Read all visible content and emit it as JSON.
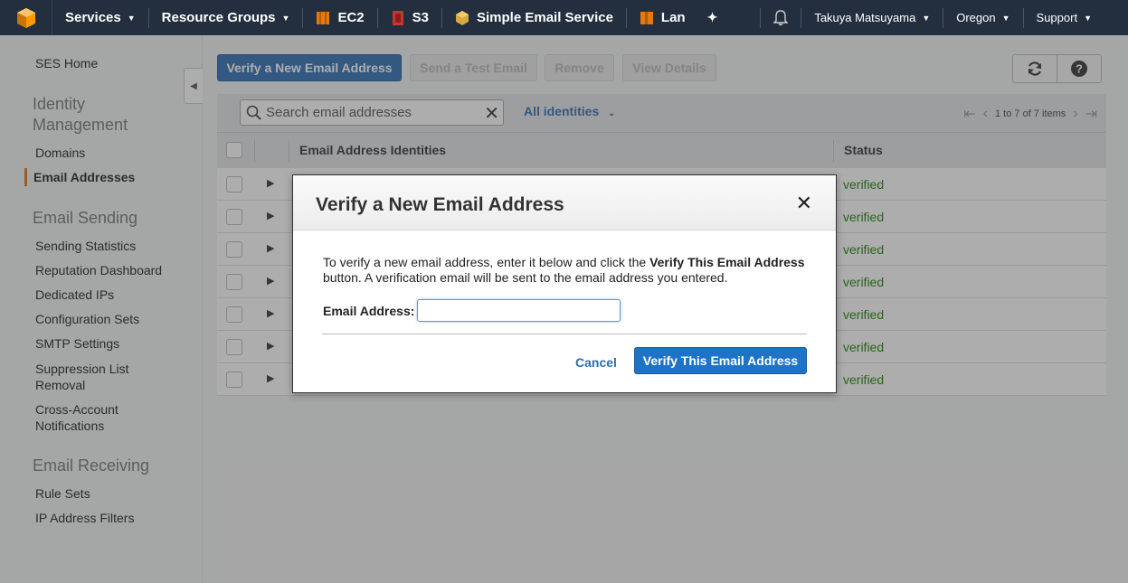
{
  "nav": {
    "services": "Services",
    "resource_groups": "Resource Groups",
    "ec2": "EC2",
    "s3": "S3",
    "ses": "Simple Email Service",
    "lambda": "Lan",
    "user": "Takuya Matsuyama",
    "region": "Oregon",
    "support": "Support",
    "colors": {
      "bar": "#232f3e",
      "ec2": "#e47911",
      "s3": "#c7372f",
      "ses": "#d9a741"
    }
  },
  "sidebar": {
    "home": "SES Home",
    "identity_heading": "Identity Management",
    "identity_items": [
      "Domains",
      "Email Addresses"
    ],
    "sending_heading": "Email Sending",
    "sending_items": [
      "Sending Statistics",
      "Reputation Dashboard",
      "Dedicated IPs",
      "Configuration Sets",
      "SMTP Settings",
      "Suppression List Removal",
      "Cross-Account Notifications"
    ],
    "receiving_heading": "Email Receiving",
    "receiving_items": [
      "Rule Sets",
      "IP Address Filters"
    ],
    "active_item": "Email Addresses"
  },
  "toolbar": {
    "verify_new": "Verify a New Email Address",
    "send_test": "Send a Test Email",
    "remove": "Remove",
    "view_details": "View Details"
  },
  "filter": {
    "search_placeholder": "Search email addresses",
    "dropdown": "All identities",
    "pager": "1 to 7 of 7 items"
  },
  "table": {
    "col_identity": "Email Address Identities",
    "col_status": "Status",
    "rows": [
      "verified",
      "verified",
      "verified",
      "verified",
      "verified",
      "verified",
      "verified"
    ]
  },
  "modal": {
    "title": "Verify a New Email Address",
    "body_pre": "To verify a new email address, enter it below and click the ",
    "body_bold": "Verify This Email Address",
    "body_post": " button. A verification email will be sent to the email address you entered.",
    "field_label": "Email Address:",
    "field_value": "",
    "cancel": "Cancel",
    "submit": "Verify This Email Address"
  }
}
